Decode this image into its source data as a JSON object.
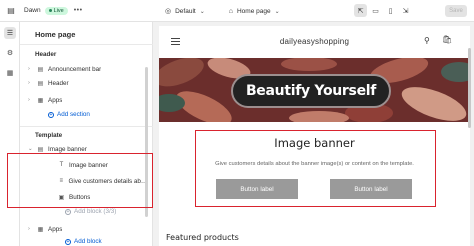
{
  "topbar": {
    "theme_name": "Dawn",
    "live_badge": "Live",
    "more_glyph": "•••",
    "theme_select": "Default",
    "page_select": "Home page",
    "save_label": "Save",
    "icons": [
      "exit-icon",
      "more-icon",
      "theme-icon",
      "home-icon",
      "inspector-icon",
      "desktop-icon",
      "mobile-icon",
      "fullscreen-icon"
    ]
  },
  "rail": {
    "icons": [
      "sections-icon",
      "theme-settings-icon",
      "app-embeds-icon"
    ]
  },
  "sidebar": {
    "title": "Home page",
    "header_group": "Header",
    "header_items": [
      {
        "label": "Announcement bar",
        "icon": "announcement-icon"
      },
      {
        "label": "Header",
        "icon": "header-icon"
      },
      {
        "label": "Apps",
        "icon": "apps-icon"
      }
    ],
    "add_section": "Add section",
    "template_group": "Template",
    "template_section": "Image banner",
    "template_children": [
      {
        "label": "Image banner",
        "icon": "text-icon"
      },
      {
        "label": "Give customers details about ...",
        "icon": "text-icon"
      },
      {
        "label": "Buttons",
        "icon": "buttons-icon"
      }
    ],
    "add_block": "Add block (3/3)",
    "apps_label": "Apps",
    "add_block2": "Add block"
  },
  "preview": {
    "site_name": "dailyeasyshopping",
    "banner_overlay": "Beautify Yourself",
    "section_title": "Image banner",
    "section_text": "Give customers details about the banner image(s) or content on the template.",
    "button1": "Button label",
    "button2": "Button label",
    "featured_heading": "Featured products"
  },
  "colors": {
    "highlight": "#d9232e",
    "link": "#005bd3",
    "live_badge_bg": "#cdf7dd"
  }
}
